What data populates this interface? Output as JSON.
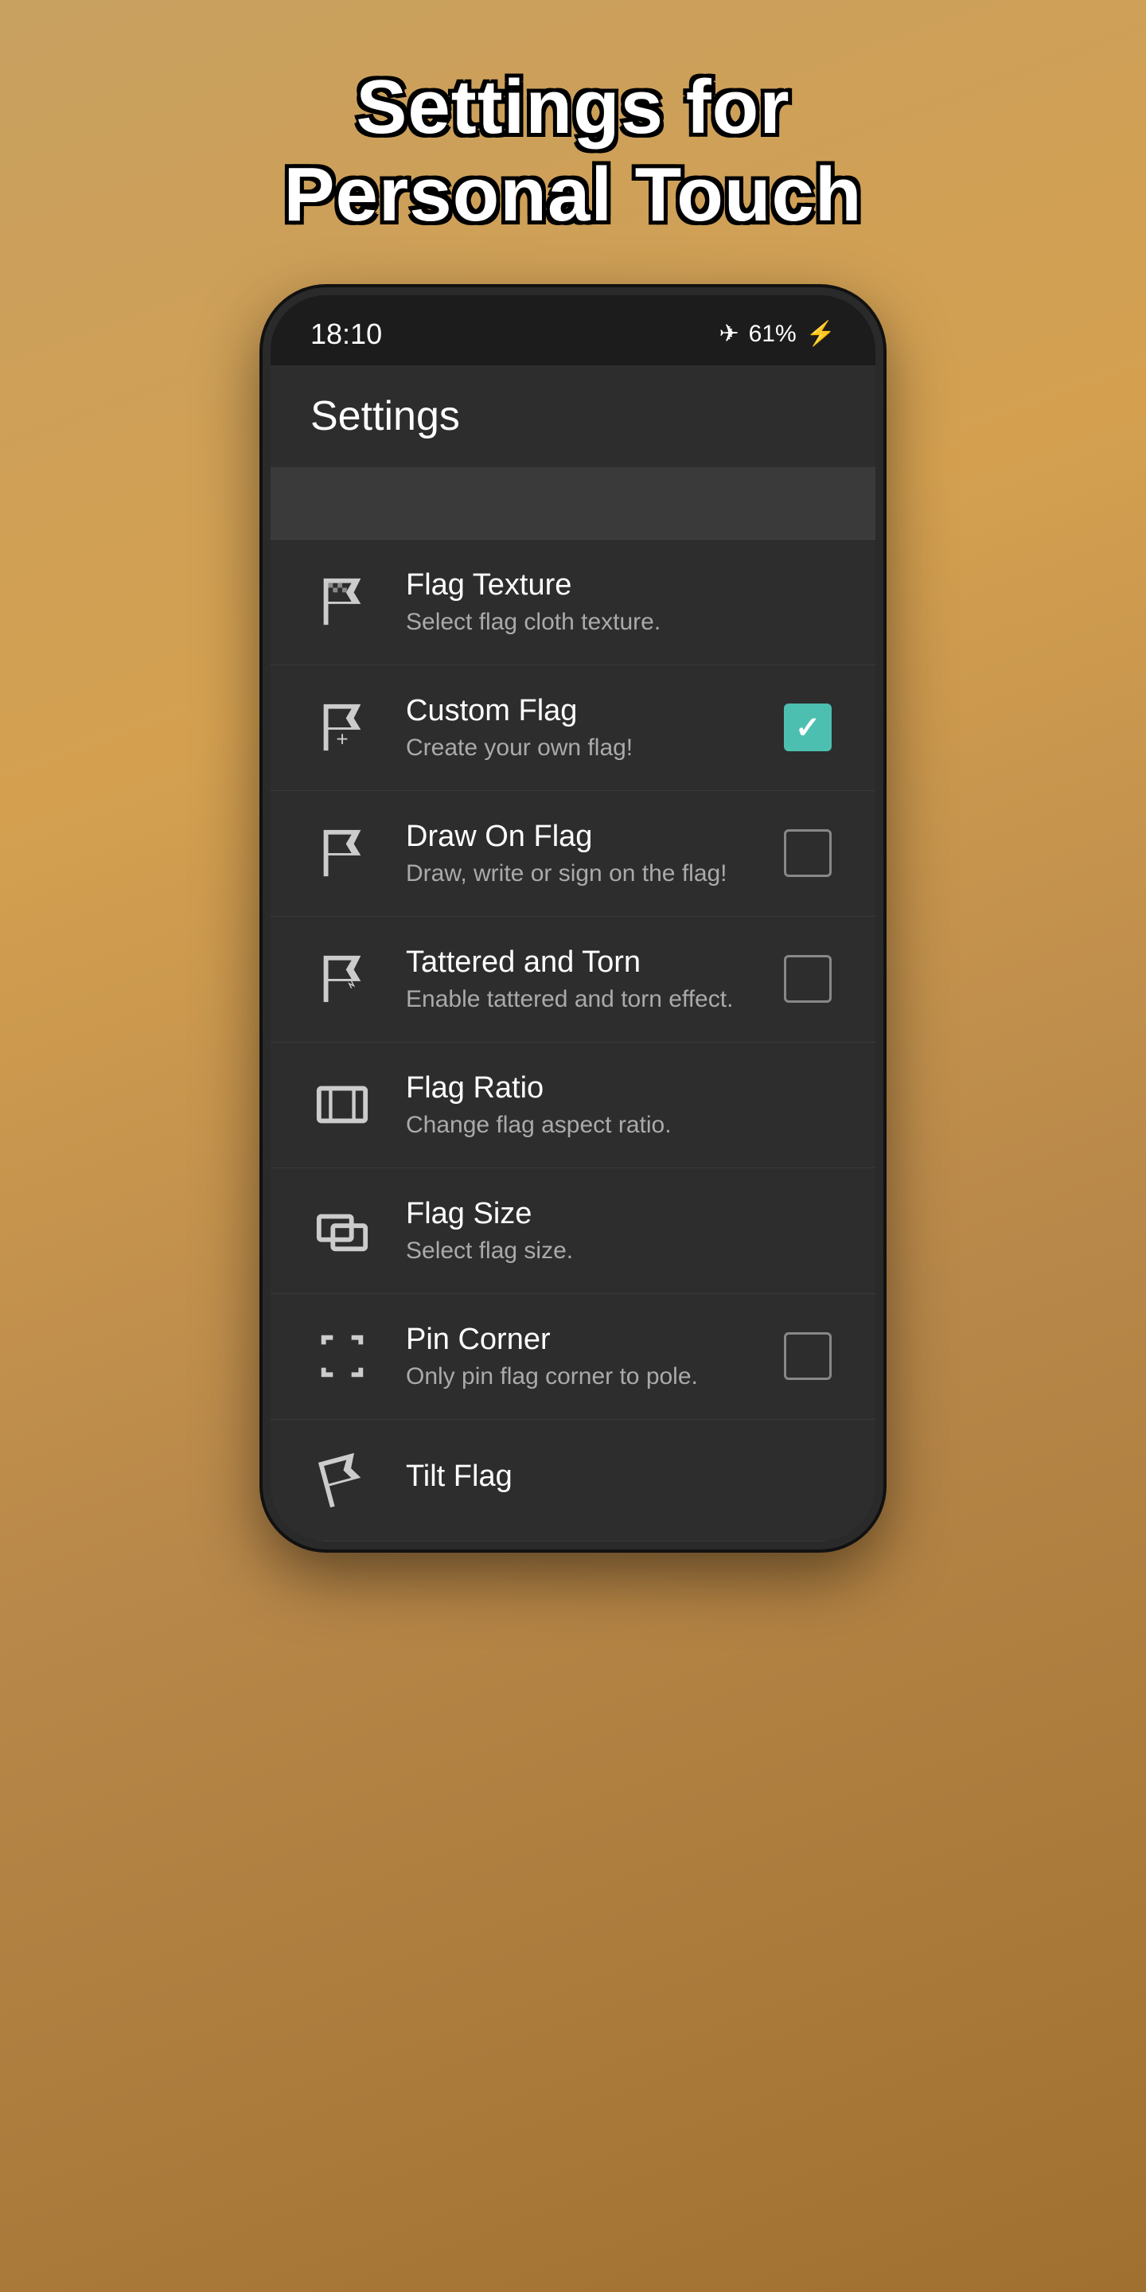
{
  "page": {
    "title_line1": "Settings for",
    "title_line2": "Personal Touch"
  },
  "status_bar": {
    "time": "18:10",
    "battery": "61%"
  },
  "app_bar": {
    "title": "Settings"
  },
  "settings_items": [
    {
      "id": "flag-texture",
      "title": "Flag Texture",
      "subtitle": "Select flag cloth texture.",
      "icon": "flag-texture-icon",
      "control": "none"
    },
    {
      "id": "custom-flag",
      "title": "Custom Flag",
      "subtitle": "Create your own flag!",
      "icon": "custom-flag-icon",
      "control": "checkbox-checked"
    },
    {
      "id": "draw-on-flag",
      "title": "Draw On Flag",
      "subtitle": "Draw, write or sign on the flag!",
      "icon": "draw-flag-icon",
      "control": "checkbox-unchecked"
    },
    {
      "id": "tattered-torn",
      "title": "Tattered and Torn",
      "subtitle": "Enable tattered and torn effect.",
      "icon": "tattered-flag-icon",
      "control": "checkbox-unchecked"
    },
    {
      "id": "flag-ratio",
      "title": "Flag Ratio",
      "subtitle": "Change flag aspect ratio.",
      "icon": "flag-ratio-icon",
      "control": "none"
    },
    {
      "id": "flag-size",
      "title": "Flag Size",
      "subtitle": "Select flag size.",
      "icon": "flag-size-icon",
      "control": "none"
    },
    {
      "id": "pin-corner",
      "title": "Pin Corner",
      "subtitle": "Only pin flag corner to pole.",
      "icon": "pin-corner-icon",
      "control": "checkbox-unchecked"
    },
    {
      "id": "tilt-flag",
      "title": "Tilt Flag",
      "subtitle": "",
      "icon": "tilt-flag-icon",
      "control": "none"
    }
  ]
}
